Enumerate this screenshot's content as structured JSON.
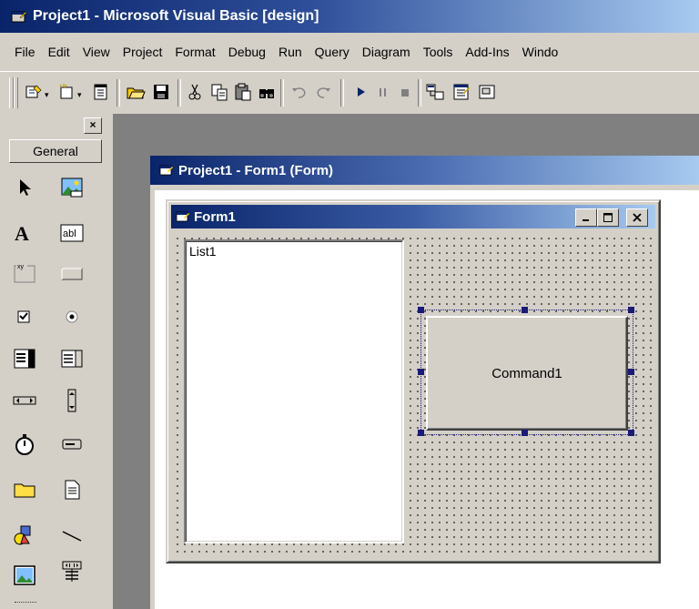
{
  "app": {
    "title": "Project1 - Microsoft Visual Basic [design]"
  },
  "menubar": {
    "items": [
      "File",
      "Edit",
      "View",
      "Project",
      "Format",
      "Debug",
      "Run",
      "Query",
      "Diagram",
      "Tools",
      "Add-Ins",
      "Windo"
    ]
  },
  "toolbox": {
    "close_label": "×",
    "tab_label": "General",
    "tools": [
      "pointer-icon",
      "picturebox-icon",
      "label-icon",
      "textbox-icon",
      "frame-icon",
      "commandbutton-icon",
      "checkbox-icon",
      "optionbutton-icon",
      "combobox-icon",
      "listbox-icon",
      "hscrollbar-icon",
      "vscrollbar-icon",
      "timer-icon",
      "drivelistbox-icon",
      "dirlistbox-icon",
      "filelistbox-icon",
      "shape-icon",
      "line-icon",
      "image-icon",
      "data-icon"
    ]
  },
  "designer": {
    "title": "Project1 - Form1 (Form)"
  },
  "form1": {
    "title": "Form1",
    "minimize_label": "_",
    "maximize_label": "□",
    "close_label": "×",
    "list1_text": "List1",
    "command1_caption": "Command1"
  },
  "colors": {
    "titlebar_start": "#0a246a",
    "titlebar_end": "#a6caf0",
    "face": "#d4d0c8",
    "mdi_background": "#808080"
  }
}
